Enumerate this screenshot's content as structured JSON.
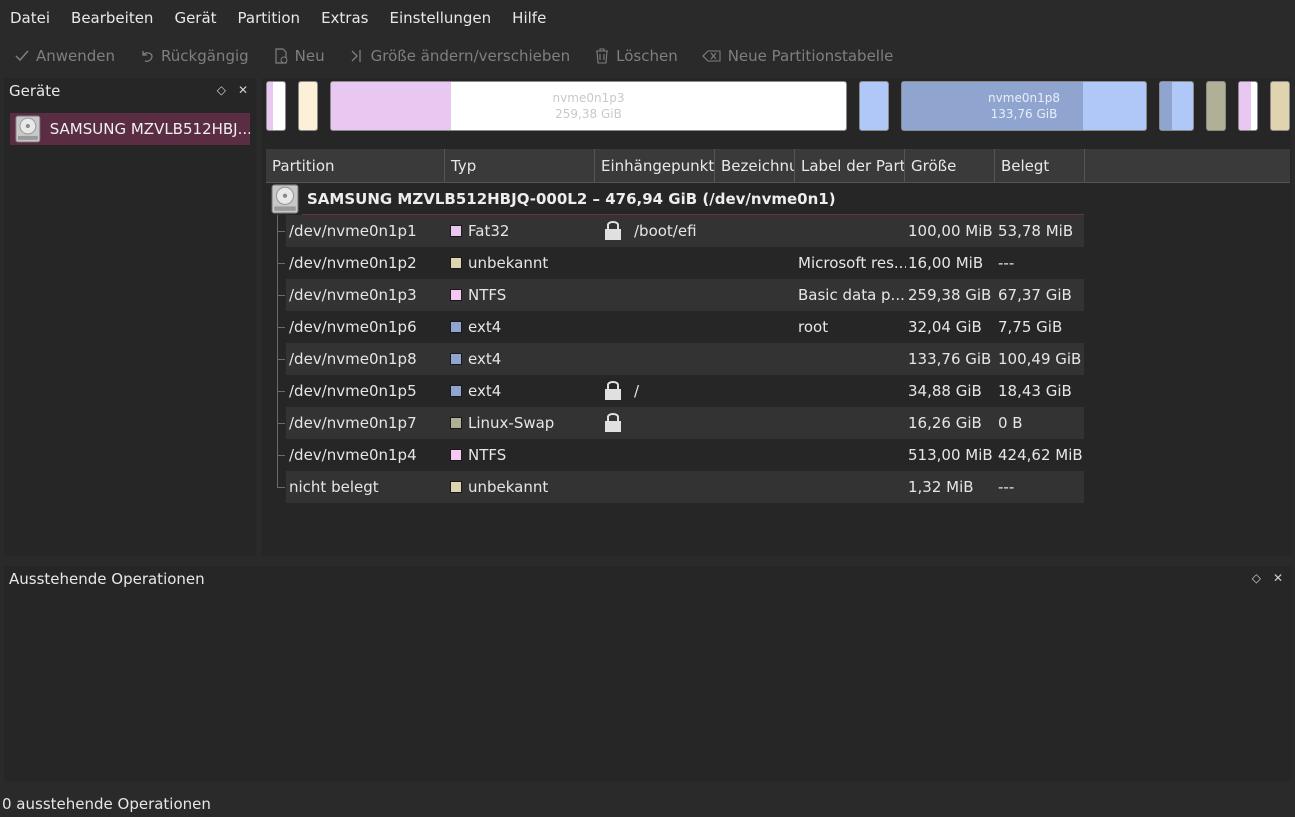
{
  "menu": [
    "Datei",
    "Bearbeiten",
    "Gerät",
    "Partition",
    "Extras",
    "Einstellungen",
    "Hilfe"
  ],
  "toolbar": {
    "apply": "Anwenden",
    "undo": "Rückgängig",
    "new": "Neu",
    "resize": "Größe ändern/verschieben",
    "delete": "Löschen",
    "new_table": "Neue Partitionstabelle"
  },
  "devices_panel": {
    "title": "Geräte",
    "device_label": "SAMSUNG MZVLB512HBJ..."
  },
  "partition_bar": {
    "p3_name": "nvme0n1p3",
    "p3_size": "259,38 GiB",
    "p8_name": "nvme0n1p8",
    "p8_size": "133,76 GiB"
  },
  "table": {
    "headers": [
      "Partition",
      "Typ",
      "Einhängepunkt",
      "Bezeichnu",
      "Label der Part",
      "Größe",
      "Belegt"
    ],
    "device_row": "SAMSUNG MZVLB512HBJQ-000L2 – 476,94 GiB (/dev/nvme0n1)",
    "rows": [
      {
        "partition": "/dev/nvme0n1p1",
        "type": "Fat32",
        "color": "#e8c8f0",
        "locked": true,
        "mount": "/boot/efi",
        "label": "",
        "partlabel": "",
        "size": "100,00 MiB",
        "used": "53,78 MiB"
      },
      {
        "partition": "/dev/nvme0n1p2",
        "type": "unbekannt",
        "color": "#e0d4b0",
        "locked": false,
        "mount": "",
        "label": "",
        "partlabel": "Microsoft res...",
        "size": "16,00 MiB",
        "used": "---"
      },
      {
        "partition": "/dev/nvme0n1p3",
        "type": "NTFS",
        "color": "#f5c8f5",
        "locked": false,
        "mount": "",
        "label": "",
        "partlabel": "Basic data p...",
        "size": "259,38 GiB",
        "used": "67,37 GiB"
      },
      {
        "partition": "/dev/nvme0n1p6",
        "type": "ext4",
        "color": "#90a4d0",
        "locked": false,
        "mount": "",
        "label": "",
        "partlabel": "root",
        "size": "32,04 GiB",
        "used": "7,75 GiB"
      },
      {
        "partition": "/dev/nvme0n1p8",
        "type": "ext4",
        "color": "#90a4d0",
        "locked": false,
        "mount": "",
        "label": "",
        "partlabel": "",
        "size": "133,76 GiB",
        "used": "100,49 GiB"
      },
      {
        "partition": "/dev/nvme0n1p5",
        "type": "ext4",
        "color": "#90a4d0",
        "locked": true,
        "mount": "/",
        "label": "",
        "partlabel": "",
        "size": "34,88 GiB",
        "used": "18,43 GiB"
      },
      {
        "partition": "/dev/nvme0n1p7",
        "type": "Linux-Swap",
        "color": "#b0b096",
        "locked": true,
        "mount": "",
        "label": "",
        "partlabel": "",
        "size": "16,26 GiB",
        "used": "0 B"
      },
      {
        "partition": "/dev/nvme0n1p4",
        "type": "NTFS",
        "color": "#f5c8f5",
        "locked": false,
        "mount": "",
        "label": "",
        "partlabel": "",
        "size": "513,00 MiB",
        "used": "424,62 MiB"
      },
      {
        "partition": "nicht belegt",
        "type": "unbekannt",
        "color": "#e0d4b0",
        "locked": false,
        "mount": "",
        "label": "",
        "partlabel": "",
        "size": "1,32 MiB",
        "used": "---"
      }
    ]
  },
  "pending_panel": {
    "title": "Ausstehende Operationen"
  },
  "status": "0 ausstehende Operationen"
}
